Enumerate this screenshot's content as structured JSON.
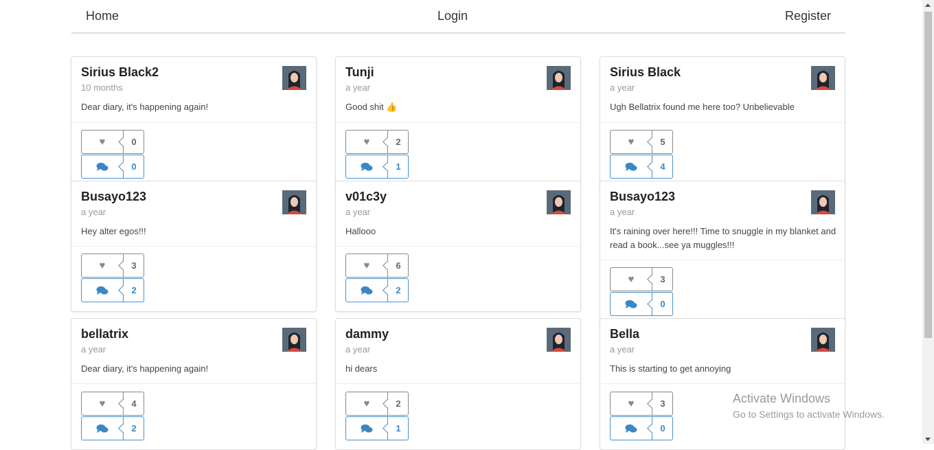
{
  "nav": {
    "home": "Home",
    "login": "Login",
    "register": "Register"
  },
  "posts": [
    {
      "name": "Sirius Black2",
      "time": "10 months",
      "text": "Dear diary, it's happening again!",
      "likes": "0",
      "comments": "0"
    },
    {
      "name": "Tunji",
      "time": "a year",
      "text": "Good shit 👍",
      "likes": "2",
      "comments": "1"
    },
    {
      "name": "Sirius Black",
      "time": "a year",
      "text": "Ugh Bellatrix found me here too? Unbelievable",
      "likes": "5",
      "comments": "4"
    },
    {
      "name": "Busayo123",
      "time": "a year",
      "text": "Hey alter egos!!!",
      "likes": "3",
      "comments": "2"
    },
    {
      "name": "v01c3y",
      "time": "a year",
      "text": "Hallooo",
      "likes": "6",
      "comments": "2"
    },
    {
      "name": "Busayo123",
      "time": "a year",
      "text": "It's raining over here!!! Time to snuggle in my blanket and read a book...see ya muggles!!!",
      "likes": "3",
      "comments": "0"
    },
    {
      "name": "bellatrix",
      "time": "a year",
      "text": "Dear diary, it's happening again!",
      "likes": "4",
      "comments": "2"
    },
    {
      "name": "dammy",
      "time": "a year",
      "text": "hi dears",
      "likes": "2",
      "comments": "1"
    },
    {
      "name": "Bella",
      "time": "a year",
      "text": "This is starting to get annoying",
      "likes": "3",
      "comments": "0"
    }
  ],
  "icons": {
    "like": "heart-icon",
    "comment": "comments-icon",
    "avatar": "avatar-image"
  },
  "colors": {
    "accent": "#3b87c6",
    "muted": "#888888"
  },
  "watermark": {
    "line1": "Activate Windows",
    "line2": "Go to Settings to activate Windows."
  }
}
